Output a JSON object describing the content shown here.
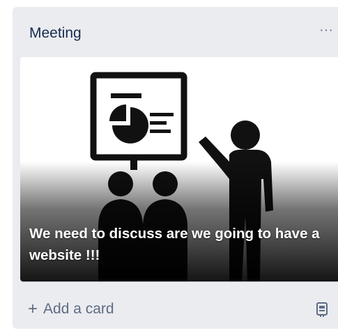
{
  "list": {
    "title": "Meeting",
    "menu_glyph": "···"
  },
  "card": {
    "title": "We need to discuss are we going to have a website !!!",
    "cover_icon": "presentation-meeting-icon"
  },
  "composer": {
    "add_label": "Add a card",
    "plus_glyph": "+",
    "template_icon": "card-template-icon"
  }
}
